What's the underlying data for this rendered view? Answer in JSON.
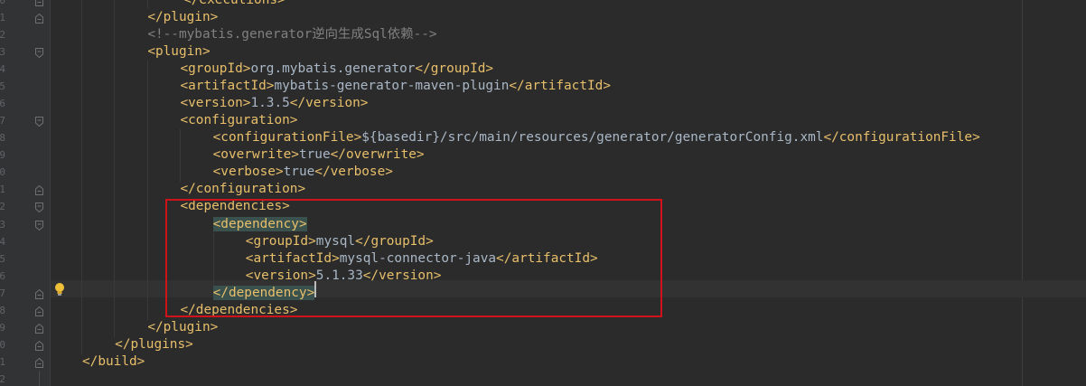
{
  "editor": {
    "line_numbers": [
      "0",
      "1",
      "2",
      "3",
      "4",
      "5",
      "6",
      "7",
      "8",
      "9",
      "0",
      "1",
      "2",
      "3",
      "4",
      "5",
      "6",
      "7",
      "8",
      "9",
      "0",
      "1",
      "2"
    ],
    "lines": [
      {
        "parts": [
          {
            "t": "b",
            "s": "</"
          },
          {
            "t": "t",
            "s": "executions"
          },
          {
            "t": "b",
            "s": ">"
          }
        ]
      },
      {
        "parts": [
          {
            "t": "b",
            "s": "</"
          },
          {
            "t": "t",
            "s": "plugin"
          },
          {
            "t": "b",
            "s": ">"
          }
        ]
      },
      {
        "parts": [
          {
            "t": "c",
            "s": "<!--mybatis.generator逆向生成Sql依赖-->"
          }
        ]
      },
      {
        "parts": [
          {
            "t": "b",
            "s": "<"
          },
          {
            "t": "t",
            "s": "plugin"
          },
          {
            "t": "b",
            "s": ">"
          }
        ]
      },
      {
        "parts": [
          {
            "t": "b",
            "s": "<"
          },
          {
            "t": "t",
            "s": "groupId"
          },
          {
            "t": "b",
            "s": ">"
          },
          {
            "t": "v",
            "s": "org.mybatis.generator"
          },
          {
            "t": "b",
            "s": "</"
          },
          {
            "t": "t",
            "s": "groupId"
          },
          {
            "t": "b",
            "s": ">"
          }
        ]
      },
      {
        "parts": [
          {
            "t": "b",
            "s": "<"
          },
          {
            "t": "t",
            "s": "artifactId"
          },
          {
            "t": "b",
            "s": ">"
          },
          {
            "t": "v",
            "s": "mybatis-generator-maven-plugin"
          },
          {
            "t": "b",
            "s": "</"
          },
          {
            "t": "t",
            "s": "artifactId"
          },
          {
            "t": "b",
            "s": ">"
          }
        ]
      },
      {
        "parts": [
          {
            "t": "b",
            "s": "<"
          },
          {
            "t": "t",
            "s": "version"
          },
          {
            "t": "b",
            "s": ">"
          },
          {
            "t": "v",
            "s": "1.3.5"
          },
          {
            "t": "b",
            "s": "</"
          },
          {
            "t": "t",
            "s": "version"
          },
          {
            "t": "b",
            "s": ">"
          }
        ]
      },
      {
        "parts": [
          {
            "t": "b",
            "s": "<"
          },
          {
            "t": "t",
            "s": "configuration"
          },
          {
            "t": "b",
            "s": ">"
          }
        ]
      },
      {
        "parts": [
          {
            "t": "b",
            "s": "<"
          },
          {
            "t": "t",
            "s": "configurationFile"
          },
          {
            "t": "b",
            "s": ">"
          },
          {
            "t": "v",
            "s": "${basedir}/src/main/resources/generator/generatorConfig.xml"
          },
          {
            "t": "b",
            "s": "</"
          },
          {
            "t": "t",
            "s": "configurationFile"
          },
          {
            "t": "b",
            "s": ">"
          }
        ]
      },
      {
        "parts": [
          {
            "t": "b",
            "s": "<"
          },
          {
            "t": "t",
            "s": "overwrite"
          },
          {
            "t": "b",
            "s": ">"
          },
          {
            "t": "v",
            "s": "true"
          },
          {
            "t": "b",
            "s": "</"
          },
          {
            "t": "t",
            "s": "overwrite"
          },
          {
            "t": "b",
            "s": ">"
          }
        ]
      },
      {
        "parts": [
          {
            "t": "b",
            "s": "<"
          },
          {
            "t": "t",
            "s": "verbose"
          },
          {
            "t": "b",
            "s": ">"
          },
          {
            "t": "v",
            "s": "true"
          },
          {
            "t": "b",
            "s": "</"
          },
          {
            "t": "t",
            "s": "verbose"
          },
          {
            "t": "b",
            "s": ">"
          }
        ]
      },
      {
        "parts": [
          {
            "t": "b",
            "s": "</"
          },
          {
            "t": "t",
            "s": "configuration"
          },
          {
            "t": "b",
            "s": ">"
          }
        ]
      },
      {
        "parts": [
          {
            "t": "b",
            "s": "<"
          },
          {
            "t": "t",
            "s": "dependencies"
          },
          {
            "t": "b",
            "s": ">"
          }
        ]
      },
      {
        "parts": [
          {
            "t": "b",
            "s": "<",
            "hl": true
          },
          {
            "t": "t",
            "s": "dependency",
            "hl": true
          },
          {
            "t": "b",
            "s": ">",
            "hl": true
          }
        ]
      },
      {
        "parts": [
          {
            "t": "b",
            "s": "<"
          },
          {
            "t": "t",
            "s": "groupId"
          },
          {
            "t": "b",
            "s": ">"
          },
          {
            "t": "v",
            "s": "mysql"
          },
          {
            "t": "b",
            "s": "</"
          },
          {
            "t": "t",
            "s": "groupId"
          },
          {
            "t": "b",
            "s": ">"
          }
        ]
      },
      {
        "parts": [
          {
            "t": "b",
            "s": "<"
          },
          {
            "t": "t",
            "s": "artifactId"
          },
          {
            "t": "b",
            "s": ">"
          },
          {
            "t": "v",
            "s": "mysql-connector-java"
          },
          {
            "t": "b",
            "s": "</"
          },
          {
            "t": "t",
            "s": "artifactId"
          },
          {
            "t": "b",
            "s": ">"
          }
        ]
      },
      {
        "parts": [
          {
            "t": "b",
            "s": "<"
          },
          {
            "t": "t",
            "s": "version"
          },
          {
            "t": "b",
            "s": ">"
          },
          {
            "t": "v",
            "s": "5.1.33"
          },
          {
            "t": "b",
            "s": "</"
          },
          {
            "t": "t",
            "s": "version"
          },
          {
            "t": "b",
            "s": ">"
          }
        ]
      },
      {
        "parts": [
          {
            "t": "b",
            "s": "</",
            "hl": true
          },
          {
            "t": "t",
            "s": "dependency",
            "hl": true
          },
          {
            "t": "b",
            "s": ">",
            "hl": true
          }
        ]
      },
      {
        "parts": [
          {
            "t": "b",
            "s": "</"
          },
          {
            "t": "t",
            "s": "dependencies"
          },
          {
            "t": "b",
            "s": ">"
          }
        ]
      },
      {
        "parts": [
          {
            "t": "b",
            "s": "</"
          },
          {
            "t": "t",
            "s": "plugin"
          },
          {
            "t": "b",
            "s": ">"
          }
        ]
      },
      {
        "parts": [
          {
            "t": "b",
            "s": "</"
          },
          {
            "t": "t",
            "s": "plugins"
          },
          {
            "t": "b",
            "s": ">"
          }
        ]
      },
      {
        "parts": [
          {
            "t": "b",
            "s": "</"
          },
          {
            "t": "t",
            "s": "build"
          },
          {
            "t": "b",
            "s": ">"
          }
        ]
      },
      {
        "parts": []
      }
    ]
  },
  "colors": {
    "background": "#2b2b2b",
    "gutter": "#313335",
    "tag": "#e8bf6a",
    "text": "#a9b7c6",
    "comment": "#808080",
    "tag_match_highlight": "#3b514d",
    "caret_row": "#323232",
    "annotation_box": "#d0121b"
  },
  "icons": {
    "fold_markers": "fold-marker-icon",
    "intention": "lightbulb-icon"
  }
}
